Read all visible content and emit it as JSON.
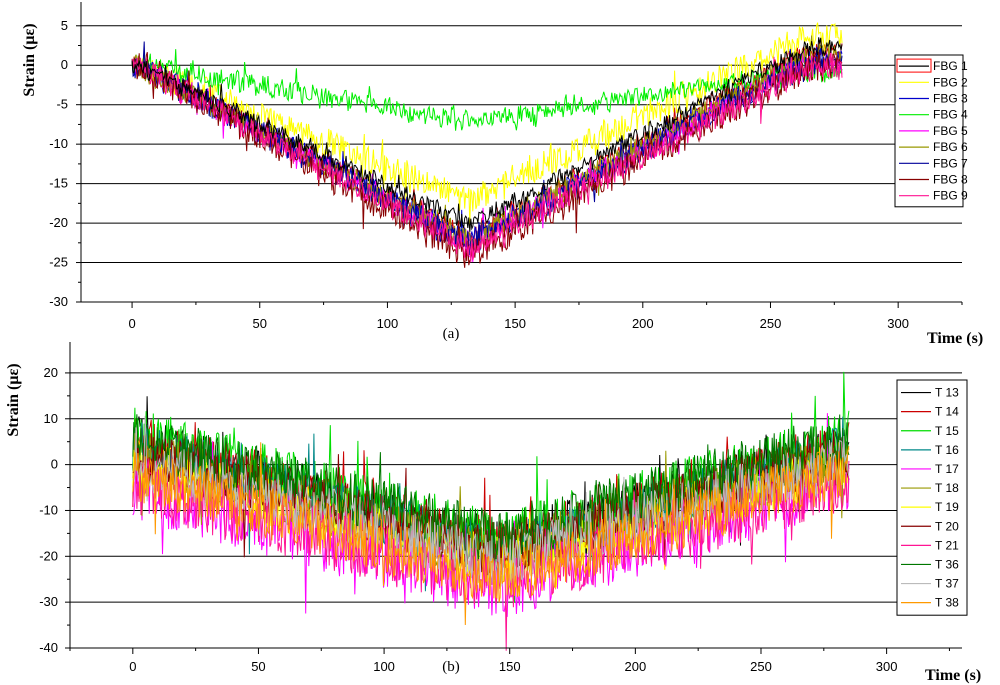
{
  "chart_data": [
    {
      "type": "line",
      "panel_label": "(a)",
      "xlabel": "Time (s)",
      "ylabel": "Strain (με)",
      "xlim": [
        -20,
        325
      ],
      "ylim": [
        -30,
        7
      ],
      "xticks": [
        0,
        50,
        100,
        150,
        200,
        250,
        300
      ],
      "yticks": [
        5,
        0,
        -5,
        -10,
        -15,
        -20,
        -25,
        -30
      ],
      "grid": "horizontal",
      "legend_position": "right",
      "series": [
        {
          "name": "FBG 1",
          "color": "#cc0000",
          "x": [
            0,
            132,
            265,
            278
          ],
          "y": [
            0,
            -22,
            1.5,
            1.5
          ],
          "noise": 1.2
        },
        {
          "name": "FBG 2",
          "color": "#ffff00",
          "x": [
            0,
            132,
            265,
            278
          ],
          "y": [
            0,
            -17.5,
            3.5,
            3.5
          ],
          "noise": 1.8
        },
        {
          "name": "FBG 3",
          "color": "#0000cc",
          "x": [
            0,
            132,
            265,
            278
          ],
          "y": [
            0,
            -22.5,
            0.5,
            0.5
          ],
          "noise": 1.5
        },
        {
          "name": "FBG 4",
          "color": "#00ee00",
          "x": [
            0,
            132,
            265,
            278
          ],
          "y": [
            0,
            -7.5,
            -1,
            -1
          ],
          "noise": 1.2
        },
        {
          "name": "FBG 5",
          "color": "#ff00ff",
          "x": [
            0,
            132,
            265,
            278
          ],
          "y": [
            0,
            -23,
            0,
            0
          ],
          "noise": 1.5
        },
        {
          "name": "FBG 6",
          "color": "#999900",
          "x": [
            0,
            132,
            265,
            278
          ],
          "y": [
            0,
            -22.5,
            1,
            1
          ],
          "noise": 1.5
        },
        {
          "name": "FBG 7",
          "color": "#000099",
          "x": [
            0,
            132,
            265,
            278
          ],
          "y": [
            0,
            -23,
            0,
            0
          ],
          "noise": 1.5
        },
        {
          "name": "FBG 8",
          "color": "#880000",
          "x": [
            0,
            132,
            265,
            278
          ],
          "y": [
            0,
            -24.5,
            -0.5,
            -0.5
          ],
          "noise": 1.8
        },
        {
          "name": "FBG 9",
          "color": "#ff1493",
          "x": [
            0,
            132,
            265,
            278
          ],
          "y": [
            0,
            -23.5,
            -0.5,
            -0.5
          ],
          "noise": 1.6
        },
        {
          "name": "FBG 1",
          "color": "#000000",
          "x": [
            0,
            132,
            265,
            278
          ],
          "y": [
            0,
            -20.5,
            2,
            2
          ],
          "noise": 1.0
        }
      ]
    },
    {
      "type": "line",
      "panel_label": "(b)",
      "xlabel": "Time (s)",
      "ylabel": "Strain (με)",
      "xlim": [
        -25,
        330
      ],
      "ylim": [
        -40,
        25
      ],
      "xticks": [
        0,
        50,
        100,
        150,
        200,
        250,
        300
      ],
      "yticks": [
        20,
        10,
        0,
        -10,
        -20,
        -30,
        -40
      ],
      "grid": "horizontal",
      "legend_position": "right",
      "series": [
        {
          "name": "T 13",
          "color": "#000000",
          "x": [
            0,
            145,
            285
          ],
          "y": [
            5,
            -18,
            4
          ],
          "noise": 6
        },
        {
          "name": "T 14",
          "color": "#cc0000",
          "x": [
            0,
            145,
            285
          ],
          "y": [
            5,
            -18,
            4
          ],
          "noise": 6
        },
        {
          "name": "T 15",
          "color": "#00dd00",
          "x": [
            0,
            145,
            285
          ],
          "y": [
            6,
            -17,
            5
          ],
          "noise": 7
        },
        {
          "name": "T 16",
          "color": "#008888",
          "x": [
            0,
            145,
            285
          ],
          "y": [
            4,
            -19,
            3
          ],
          "noise": 6
        },
        {
          "name": "T 17",
          "color": "#ff00ff",
          "x": [
            0,
            145,
            285
          ],
          "y": [
            -5,
            -27,
            -3
          ],
          "noise": 7
        },
        {
          "name": "T 18",
          "color": "#999900",
          "x": [
            0,
            145,
            285
          ],
          "y": [
            2,
            -20,
            2
          ],
          "noise": 6
        },
        {
          "name": "T 19",
          "color": "#ffff00",
          "x": [
            0,
            145,
            285
          ],
          "y": [
            0,
            -22,
            0
          ],
          "noise": 6
        },
        {
          "name": "T 20",
          "color": "#880000",
          "x": [
            0,
            145,
            285
          ],
          "y": [
            3,
            -19,
            3
          ],
          "noise": 6
        },
        {
          "name": "T 21",
          "color": "#ff1493",
          "x": [
            0,
            145,
            285
          ],
          "y": [
            -4,
            -26,
            -3
          ],
          "noise": 7
        },
        {
          "name": "T 36",
          "color": "#007700",
          "x": [
            0,
            145,
            285
          ],
          "y": [
            6,
            -16,
            6
          ],
          "noise": 6
        },
        {
          "name": "T 37",
          "color": "#bbbbbb",
          "x": [
            0,
            145,
            285
          ],
          "y": [
            1,
            -21,
            1
          ],
          "noise": 6
        },
        {
          "name": "T 38",
          "color": "#ff9900",
          "x": [
            0,
            145,
            285
          ],
          "y": [
            -2,
            -25,
            -1
          ],
          "noise": 6
        }
      ]
    }
  ]
}
